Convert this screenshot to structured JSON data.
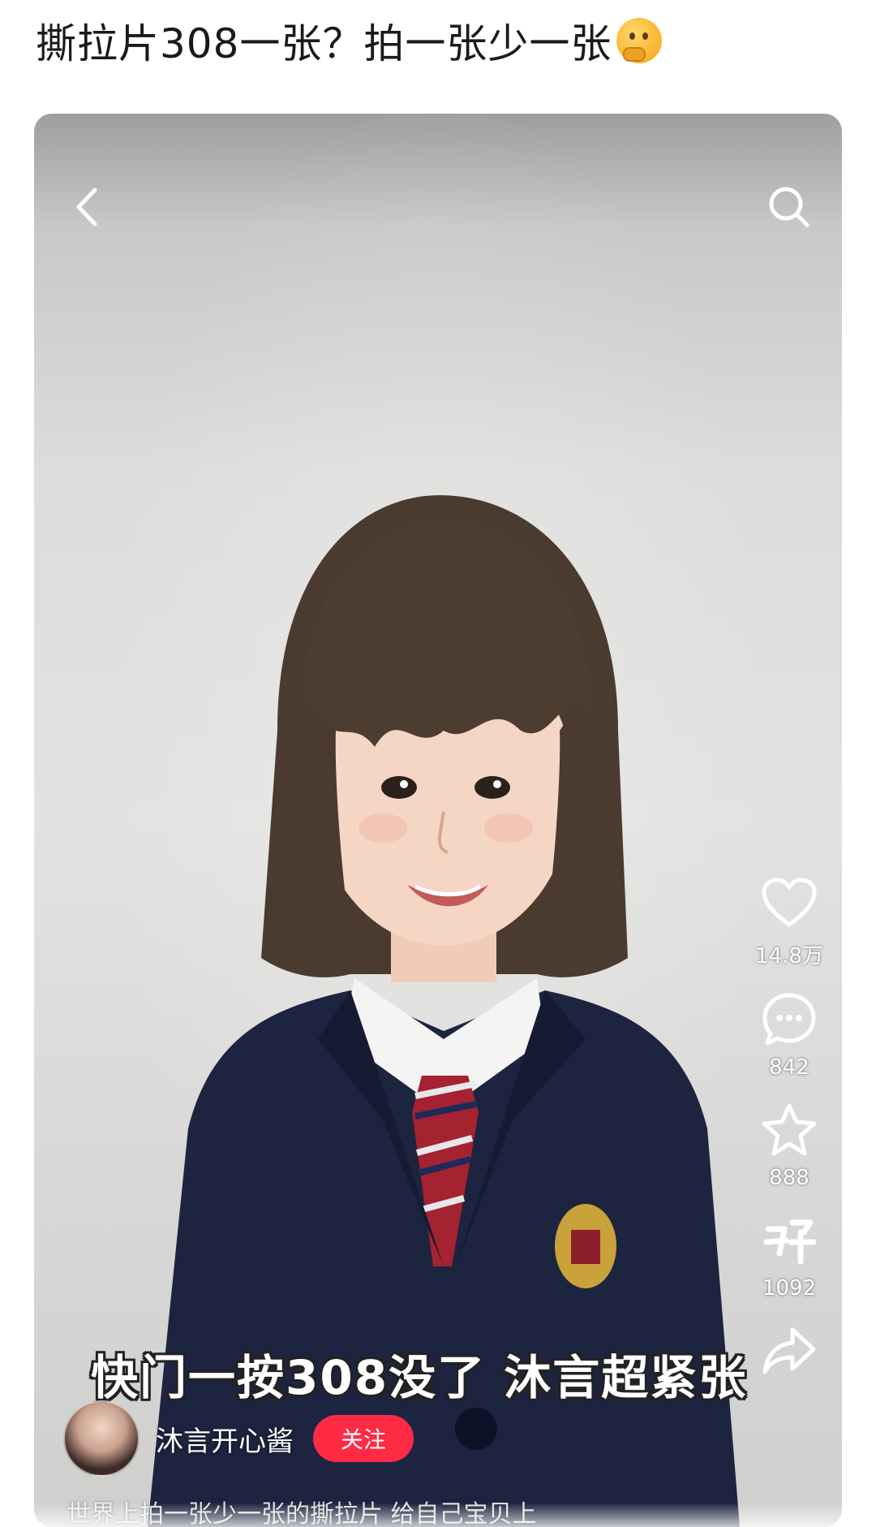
{
  "post": {
    "title": "撕拉片308一张？拍一张少一张",
    "emoji": "thinking-face-emoji"
  },
  "video": {
    "caption": "快门一按308没了 沐言超紧张",
    "author_name": "沐言开心酱",
    "follow_label": "关注",
    "description_partial": "世界上拍一张少一张的撕拉片 给自己宝贝上",
    "actions": {
      "likes": "14.8万",
      "comments": "842",
      "favorites": "888",
      "shares": "1092"
    },
    "icons": [
      "back-icon",
      "search-icon",
      "heart-icon",
      "comment-icon",
      "star-icon",
      "great-icon",
      "share-icon"
    ],
    "colors": {
      "follow_button": "#ff2b45",
      "blazer": "#1d2440",
      "tie_red": "#a52231",
      "wall": "#dcdcda"
    }
  }
}
